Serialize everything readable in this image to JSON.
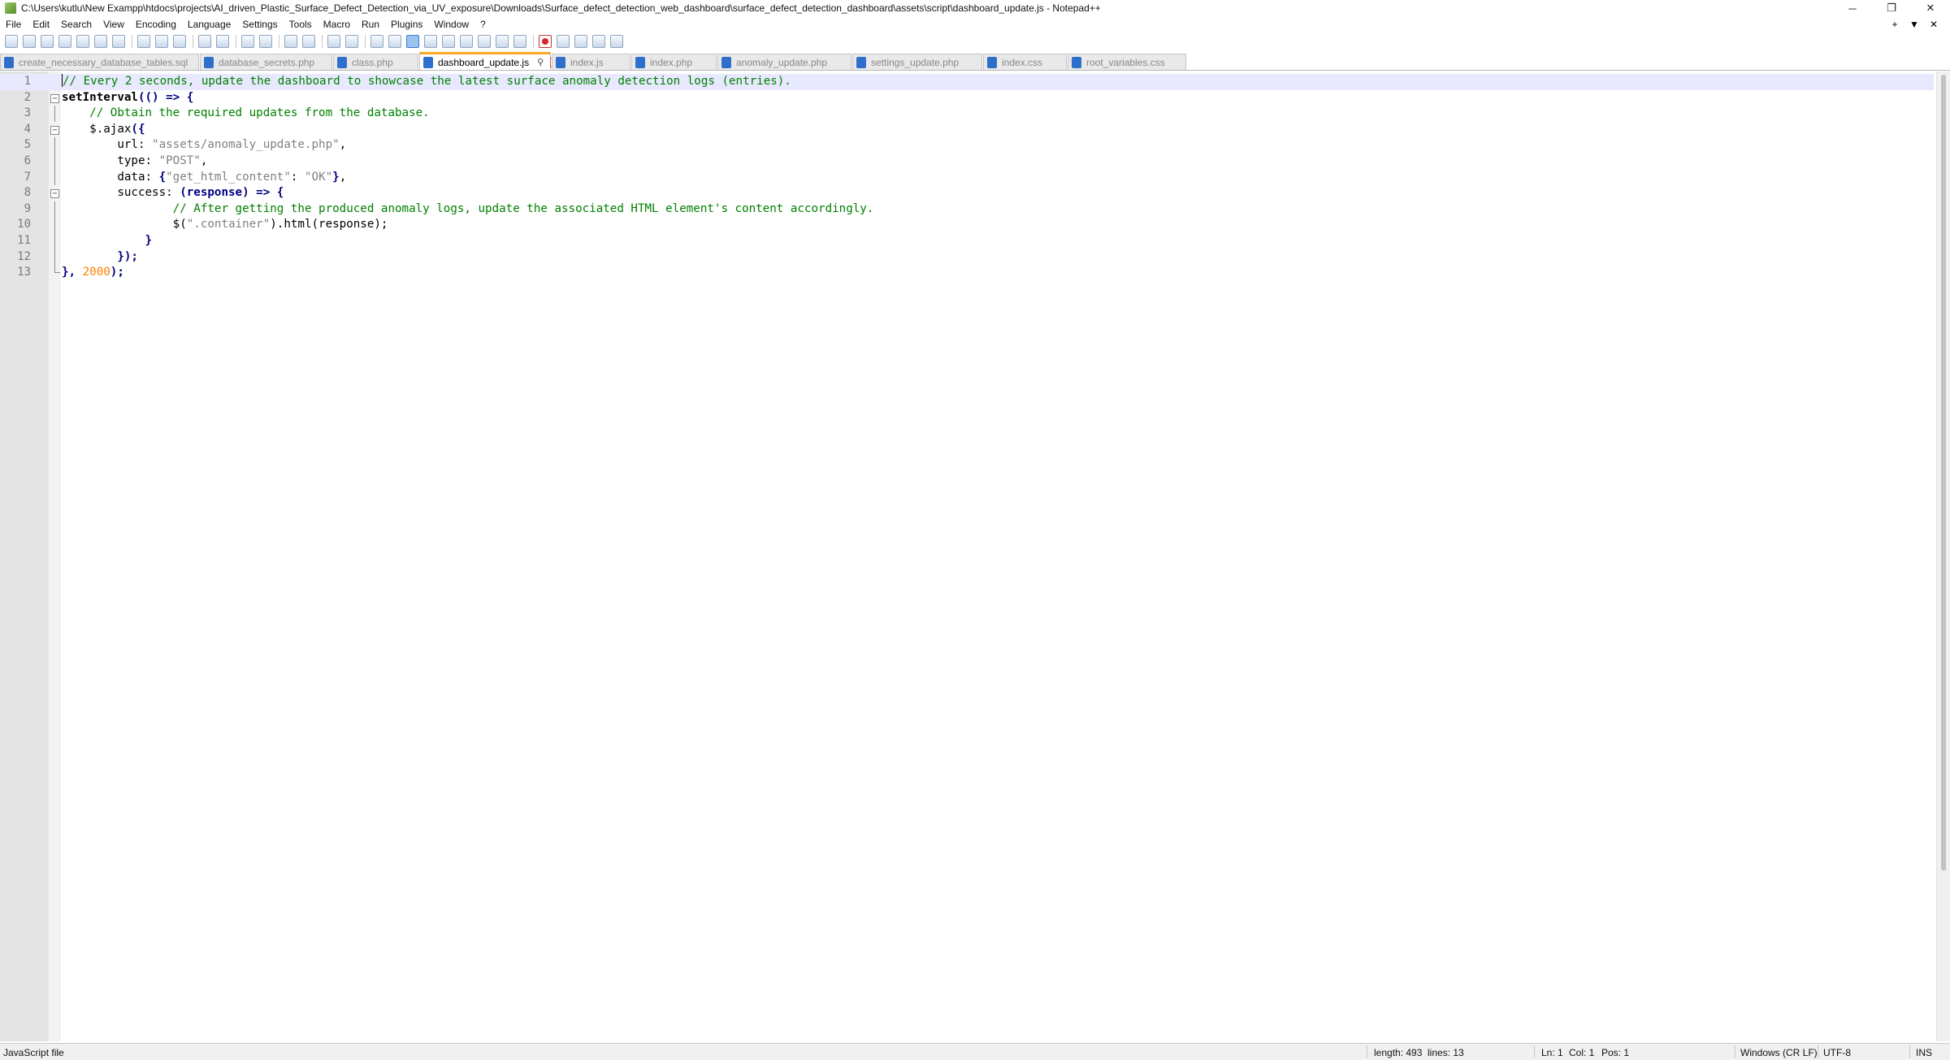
{
  "window": {
    "title": "C:\\Users\\kutlu\\New Exampp\\htdocs\\projects\\AI_driven_Plastic_Surface_Defect_Detection_via_UV_exposure\\Downloads\\Surface_defect_detection_web_dashboard\\surface_defect_detection_dashboard\\assets\\script\\dashboard_update.js - Notepad++",
    "controls": {
      "minimize": "─",
      "restore": "❐",
      "close": "✕"
    }
  },
  "menu": {
    "items": [
      "File",
      "Edit",
      "Search",
      "View",
      "Encoding",
      "Language",
      "Settings",
      "Tools",
      "Macro",
      "Run",
      "Plugins",
      "Window",
      "?"
    ],
    "right": [
      "+",
      "▼",
      "✕"
    ]
  },
  "tabs": [
    {
      "label": "create_necessary_database_tables.sql",
      "active": false
    },
    {
      "label": "database_secrets.php",
      "active": false
    },
    {
      "label": "class.php",
      "active": false
    },
    {
      "label": "dashboard_update.js",
      "active": true
    },
    {
      "label": "index.js",
      "active": false
    },
    {
      "label": "index.php",
      "active": false
    },
    {
      "label": "anomaly_update.php",
      "active": false
    },
    {
      "label": "settings_update.php",
      "active": false
    },
    {
      "label": "index.css",
      "active": false
    },
    {
      "label": "root_variables.css",
      "active": false
    }
  ],
  "editor": {
    "line_numbers": [
      "1",
      "2",
      "3",
      "4",
      "5",
      "6",
      "7",
      "8",
      "9",
      "10",
      "11",
      "12",
      "13"
    ],
    "code": {
      "l1": "// Every 2 seconds, update the dashboard to showcase the latest surface anomaly detection logs (entries).",
      "l2_fn": "setInterval",
      "l2_rest": "(() => {",
      "l3": "    // Obtain the required updates from the database.",
      "l4_pre": "    $.ajax",
      "l4_op": "({",
      "l5_key": "        url: ",
      "l5_str": "\"assets/anomaly_update.php\"",
      "l5_end": ",",
      "l6_key": "        type: ",
      "l6_str": "\"POST\"",
      "l6_end": ",",
      "l7_key": "        data: ",
      "l7_op1": "{",
      "l7_str1": "\"get_html_content\"",
      "l7_colon": ": ",
      "l7_str2": "\"OK\"",
      "l7_op2": "}",
      "l7_end": ",",
      "l8_key": "        success: ",
      "l8_rest": "(response) => {",
      "l9": "                // After getting the produced anomaly logs, update the associated HTML element's content accordingly.",
      "l10_pre": "                $(",
      "l10_str": "\".container\"",
      "l10_rest": ").html(response);",
      "l11": "            }",
      "l12": "        });",
      "l13_op": "}, ",
      "l13_num": "2000",
      "l13_end": ");"
    }
  },
  "status": {
    "file_type": "JavaScript file",
    "length": "length: 493",
    "lines": "lines: 13",
    "ln": "Ln: 1",
    "col": "Col: 1",
    "pos": "Pos: 1",
    "eol": "Windows (CR LF)",
    "encoding": "UTF-8",
    "mode": "INS"
  }
}
